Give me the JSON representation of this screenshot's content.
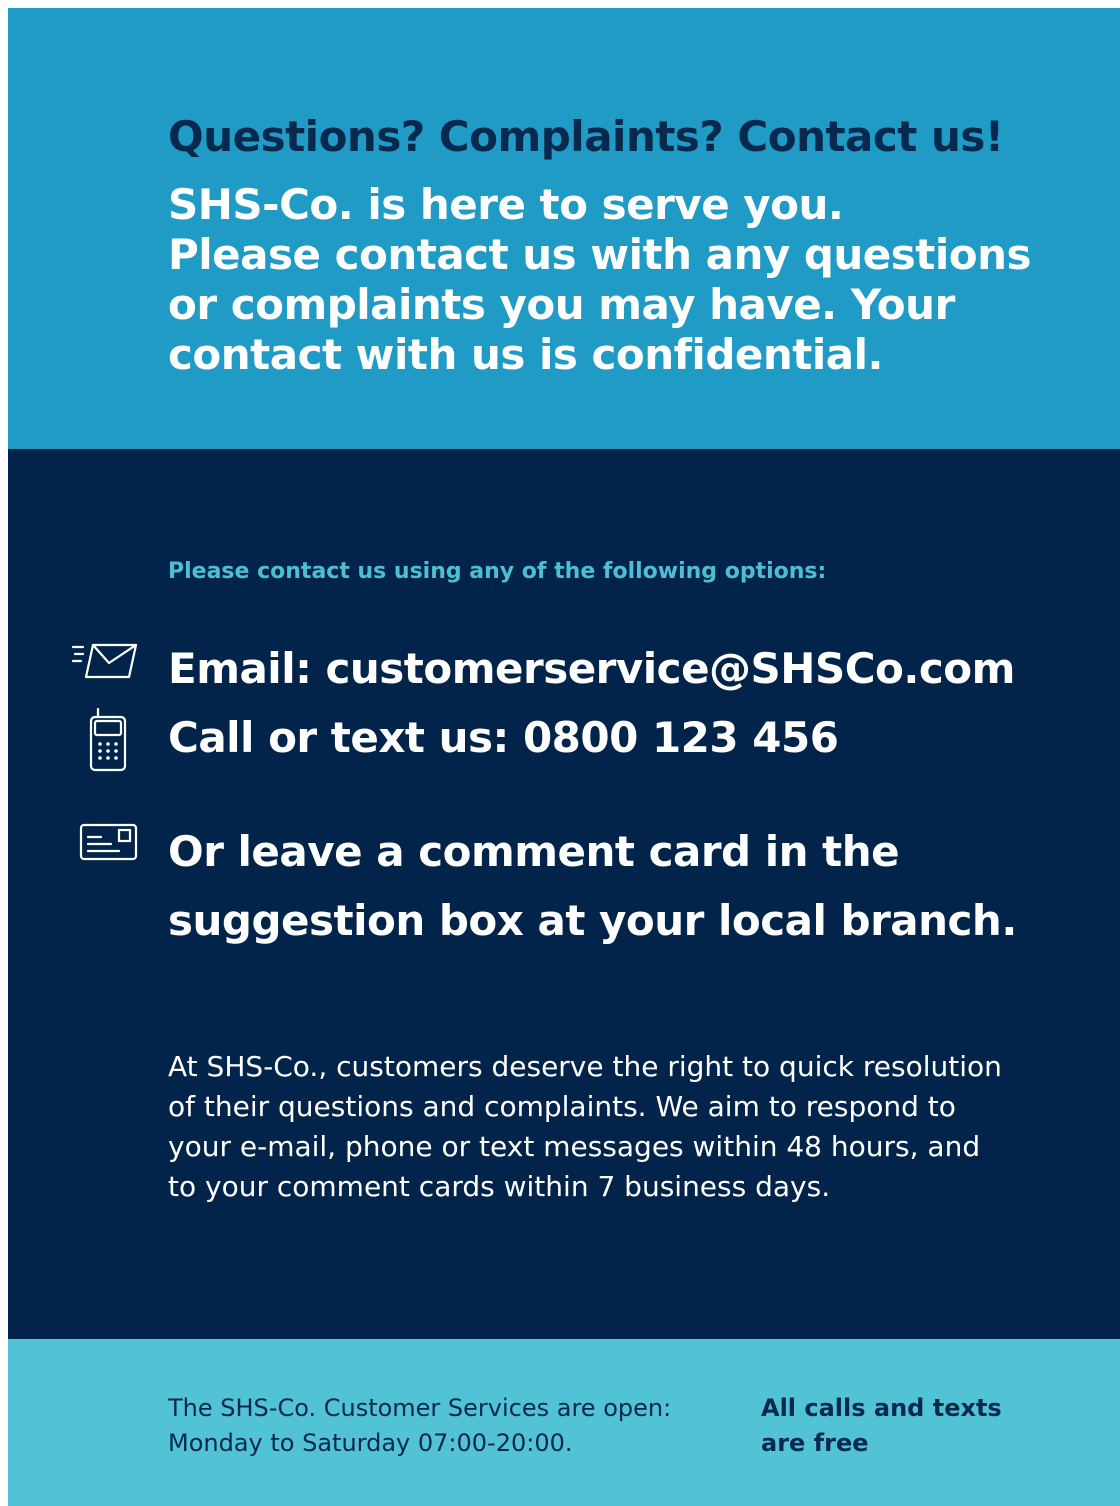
{
  "header": {
    "heading": "Questions? Complaints? Contact us!",
    "intro_lines": [
      "SHS-Co. is here to serve you.",
      "Please contact us with any questions",
      "or complaints you may have. Your",
      "contact with us is confidential."
    ]
  },
  "contact": {
    "options_label": "Please contact us using any of the following options:",
    "email": "Email: customerservice@SHSCo.com",
    "phone": "Call or text us: 0800 123 456",
    "card_lines": [
      "Or leave a comment card in the",
      "suggestion box at your local branch."
    ],
    "icons": {
      "email": "email-envelope-icon",
      "phone": "mobile-phone-icon",
      "card": "comment-card-icon"
    }
  },
  "body": {
    "lines": [
      "At SHS-Co., customers deserve the right to quick resolution",
      "of their questions and complaints. We aim to respond to",
      "your e-mail, phone or text messages within 48 hours, and",
      "to your comment cards within 7 business days."
    ]
  },
  "footer": {
    "hours_lines": [
      "The SHS-Co. Customer Services are open:",
      "Monday to Saturday 07:00-20:00."
    ],
    "free_lines": [
      "All calls and texts",
      "are free"
    ]
  },
  "colors": {
    "top_band": "#1f9bc6",
    "middle_band": "#03244a",
    "bottom_band": "#52c2d6",
    "heading": "#07294d",
    "accent": "#4dbfd4"
  }
}
